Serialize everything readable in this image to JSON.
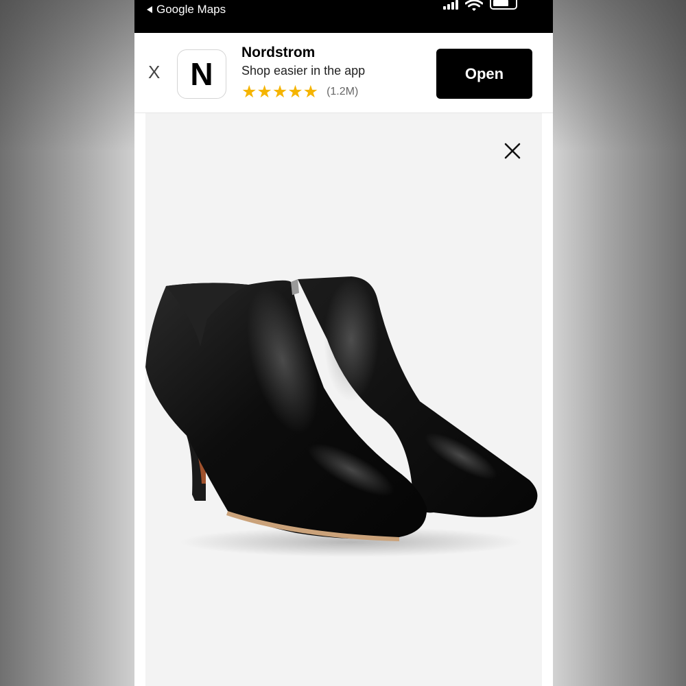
{
  "status_bar": {
    "back_label": "Google Maps",
    "icons": [
      "back-arrow-icon",
      "signal-icon",
      "wifi-icon",
      "battery-icon"
    ]
  },
  "app_banner": {
    "dismiss_label": "X",
    "app_icon_letter": "N",
    "app_name": "Nordstrom",
    "tagline": "Shop easier in the app",
    "stars": "★★★★★",
    "rating_count": "(1.2M)",
    "open_label": "Open",
    "star_color": "#f5b400",
    "button_color": "#000000"
  },
  "product_viewer": {
    "close_icon": "close-icon",
    "image_subject": "black leather pointed-toe kitten heel ankle booties"
  }
}
